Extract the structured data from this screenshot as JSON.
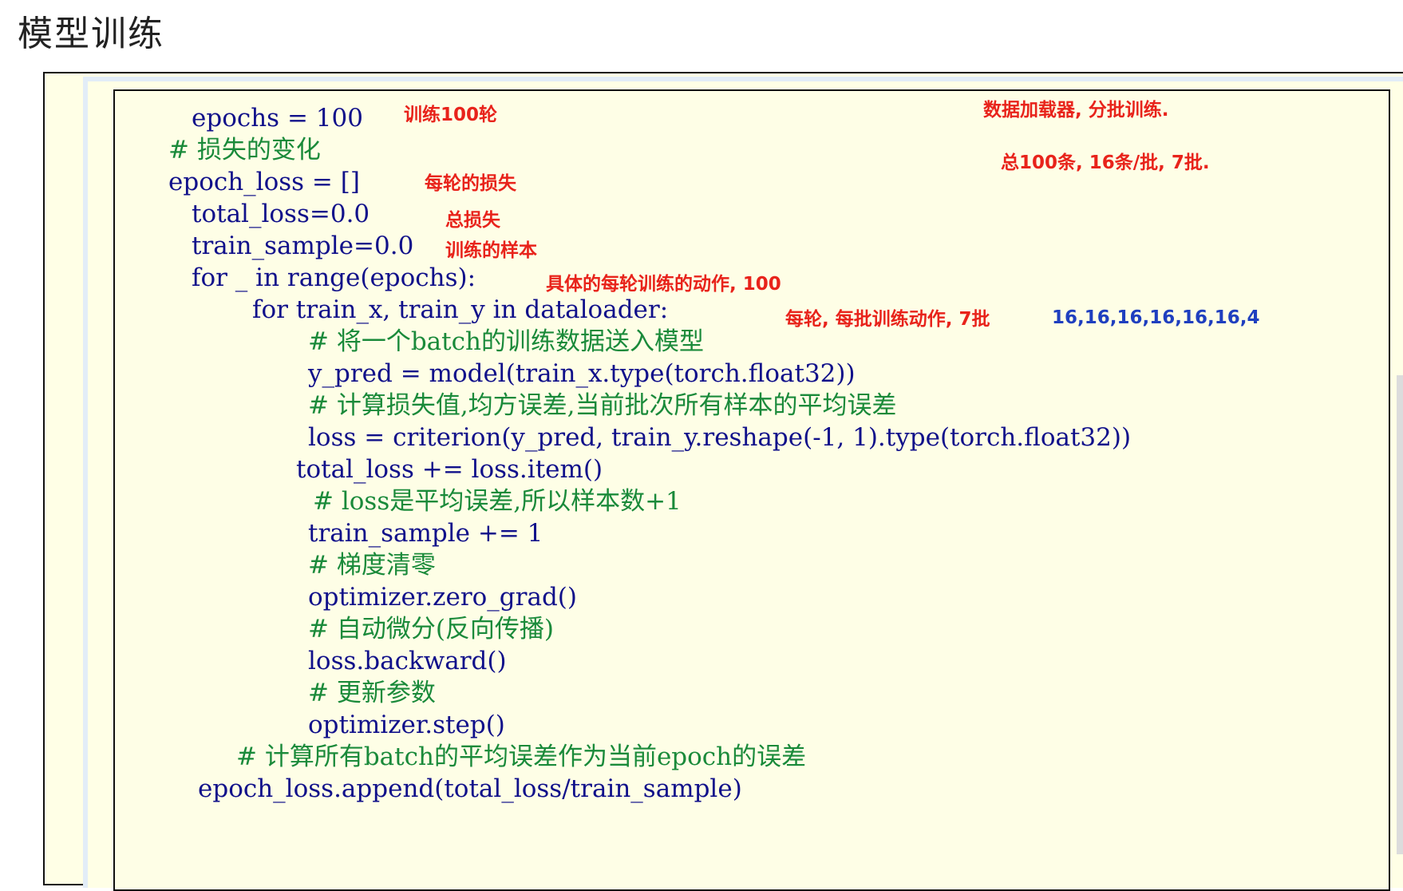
{
  "page": {
    "title": "模型训练"
  },
  "code": {
    "l1": "epochs = 100",
    "l2": "# 损失的变化",
    "l3": "epoch_loss = []",
    "l4": "total_loss=0.0",
    "l5": "train_sample=0.0",
    "l6": "for _ in range(epochs):",
    "l7": "for train_x, train_y in dataloader:",
    "l8": "# 将一个batch的训练数据送入模型",
    "l9": "y_pred = model(train_x.type(torch.float32))",
    "l10": "# 计算损失值,均方误差,当前批次所有样本的平均误差",
    "l11": "loss = criterion(y_pred, train_y.reshape(-1, 1).type(torch.float32))",
    "l12": "total_loss += loss.item()",
    "l13": "# loss是平均误差,所以样本数+1",
    "l14": "train_sample += 1",
    "l15": "# 梯度清零",
    "l16": "optimizer.zero_grad()",
    "l17": "# 自动微分(反向传播)",
    "l18": "loss.backward()",
    "l19": "# 更新参数",
    "l20": "optimizer.step()",
    "l21": "# 计算所有batch的平均误差作为当前epoch的误差",
    "l22": "epoch_loss.append(total_loss/train_sample)"
  },
  "notes": {
    "n1": "训练100轮",
    "n2": "数据加载器, 分批训练.",
    "n3": "总100条, 16条/批, 7批.",
    "n4": "每轮的损失",
    "n5": "总损失",
    "n6": "训练的样本",
    "n7": "具体的每轮训练的动作, 100",
    "n8": "每轮, 每批训练动作, 7批",
    "n9": "16,16,16,16,16,16,4"
  },
  "colors": {
    "code": "#10108a",
    "comment": "#1a8a3a",
    "note_red": "#e8231b",
    "note_blue": "#1f3fbf",
    "background": "#fefee6"
  }
}
